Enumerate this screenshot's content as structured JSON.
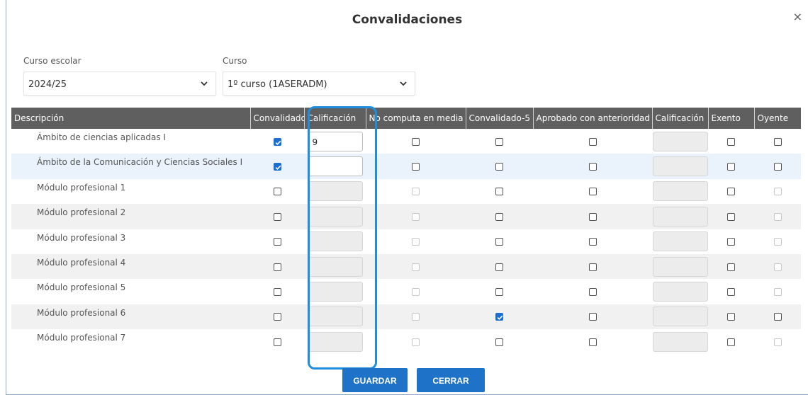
{
  "dialog": {
    "title": "Convalidaciones",
    "close_label": "×"
  },
  "filters": {
    "curso_escolar": {
      "label": "Curso escolar",
      "value": "2024/25"
    },
    "curso": {
      "label": "Curso",
      "value": "1º curso (1ASERADM)"
    }
  },
  "table": {
    "headers": [
      "Descripción",
      "Convalidado",
      "Calificación",
      "No computa en media",
      "Convalidado-5",
      "Aprobado con anterioridad",
      "Calificación",
      "Exento",
      "Oyente"
    ],
    "rows": [
      {
        "descripcion": "Ámbito de ciencias aplicadas I",
        "convalidado": true,
        "calificacion": "9",
        "calificacion_enabled": true,
        "no_computa": false,
        "no_computa_enabled": true,
        "convalidado5": false,
        "aprobado": false,
        "exento": false,
        "oyente": false,
        "oyente_enabled": true
      },
      {
        "descripcion": "Ámbito de la Comunicación y Ciencias Sociales I",
        "convalidado": true,
        "calificacion": "",
        "calificacion_enabled": true,
        "no_computa": false,
        "no_computa_enabled": true,
        "convalidado5": false,
        "aprobado": false,
        "exento": false,
        "oyente": false,
        "oyente_enabled": true
      },
      {
        "descripcion": "Módulo profesional 1",
        "convalidado": false,
        "calificacion": "",
        "calificacion_enabled": false,
        "no_computa": false,
        "no_computa_enabled": false,
        "convalidado5": false,
        "aprobado": false,
        "exento": false,
        "oyente": false,
        "oyente_enabled": false
      },
      {
        "descripcion": "Módulo profesional 2",
        "convalidado": false,
        "calificacion": "",
        "calificacion_enabled": false,
        "no_computa": false,
        "no_computa_enabled": false,
        "convalidado5": false,
        "aprobado": false,
        "exento": false,
        "oyente": false,
        "oyente_enabled": false
      },
      {
        "descripcion": "Módulo profesional 3",
        "convalidado": false,
        "calificacion": "",
        "calificacion_enabled": false,
        "no_computa": false,
        "no_computa_enabled": false,
        "convalidado5": false,
        "aprobado": false,
        "exento": false,
        "oyente": false,
        "oyente_enabled": false
      },
      {
        "descripcion": "Módulo profesional 4",
        "convalidado": false,
        "calificacion": "",
        "calificacion_enabled": false,
        "no_computa": false,
        "no_computa_enabled": false,
        "convalidado5": false,
        "aprobado": false,
        "exento": false,
        "oyente": false,
        "oyente_enabled": false
      },
      {
        "descripcion": "Módulo profesional 5",
        "convalidado": false,
        "calificacion": "",
        "calificacion_enabled": false,
        "no_computa": false,
        "no_computa_enabled": false,
        "convalidado5": false,
        "aprobado": false,
        "exento": false,
        "oyente": false,
        "oyente_enabled": false
      },
      {
        "descripcion": "Módulo profesional 6",
        "convalidado": false,
        "calificacion": "",
        "calificacion_enabled": false,
        "no_computa": false,
        "no_computa_enabled": false,
        "convalidado5": true,
        "aprobado": false,
        "exento": false,
        "oyente": false,
        "oyente_enabled": true
      },
      {
        "descripcion": "Módulo profesional 7",
        "convalidado": false,
        "calificacion": "",
        "calificacion_enabled": false,
        "no_computa": false,
        "no_computa_enabled": false,
        "convalidado5": false,
        "aprobado": false,
        "exento": false,
        "oyente": false,
        "oyente_enabled": false
      }
    ]
  },
  "buttons": {
    "guardar": "GUARDAR",
    "cerrar": "CERRAR"
  },
  "colors": {
    "accent": "#1e73c8",
    "highlight": "#1e8fe0",
    "header_bg": "#5f5f5f"
  },
  "icons": {
    "close": "close-icon",
    "dropdown": "chevron-down-icon",
    "check": "checkmark-icon"
  }
}
